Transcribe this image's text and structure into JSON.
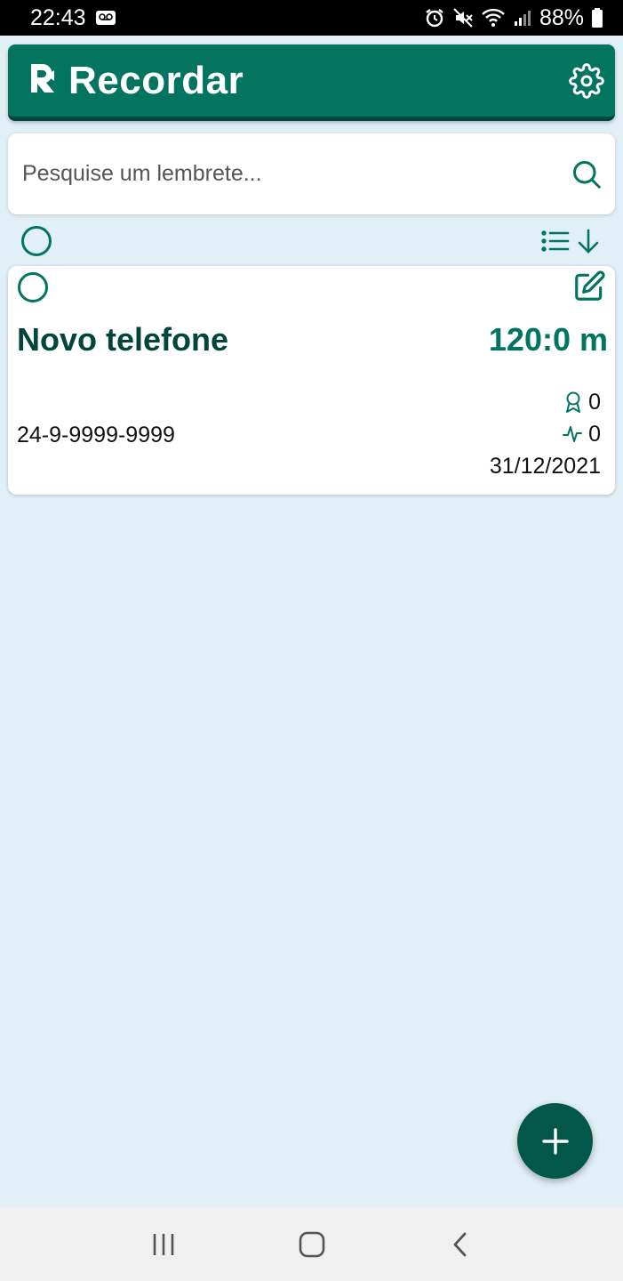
{
  "status_bar": {
    "time": "22:43",
    "battery": "88%",
    "icons": [
      "voicemail-icon",
      "alarm-icon",
      "mute-icon",
      "wifi-icon",
      "signal-icon",
      "battery-icon"
    ]
  },
  "app_bar": {
    "title": "Recordar",
    "logo_icon": "recordar-logo-icon",
    "settings_icon": "gear-icon"
  },
  "search": {
    "placeholder": "Pesquise um lembrete...",
    "value": "",
    "icon": "search-icon"
  },
  "list_toolbar": {
    "select_all_icon": "circle-checkbox-icon",
    "sort_icon": "sort-list-down-icon"
  },
  "reminders": [
    {
      "title": "Novo telefone",
      "duration": "120:0 m",
      "phone": "24-9-9999-9999",
      "award_count": "0",
      "activity_count": "0",
      "date": "31/12/2021"
    }
  ],
  "fab": {
    "icon": "plus-icon"
  },
  "nav_bar": {
    "icons": [
      "recent-apps-icon",
      "home-icon",
      "back-icon"
    ]
  },
  "colors": {
    "primary": "#02745f",
    "primary_dark": "#02463a",
    "background": "#e1eff6",
    "fab": "#02564a"
  }
}
